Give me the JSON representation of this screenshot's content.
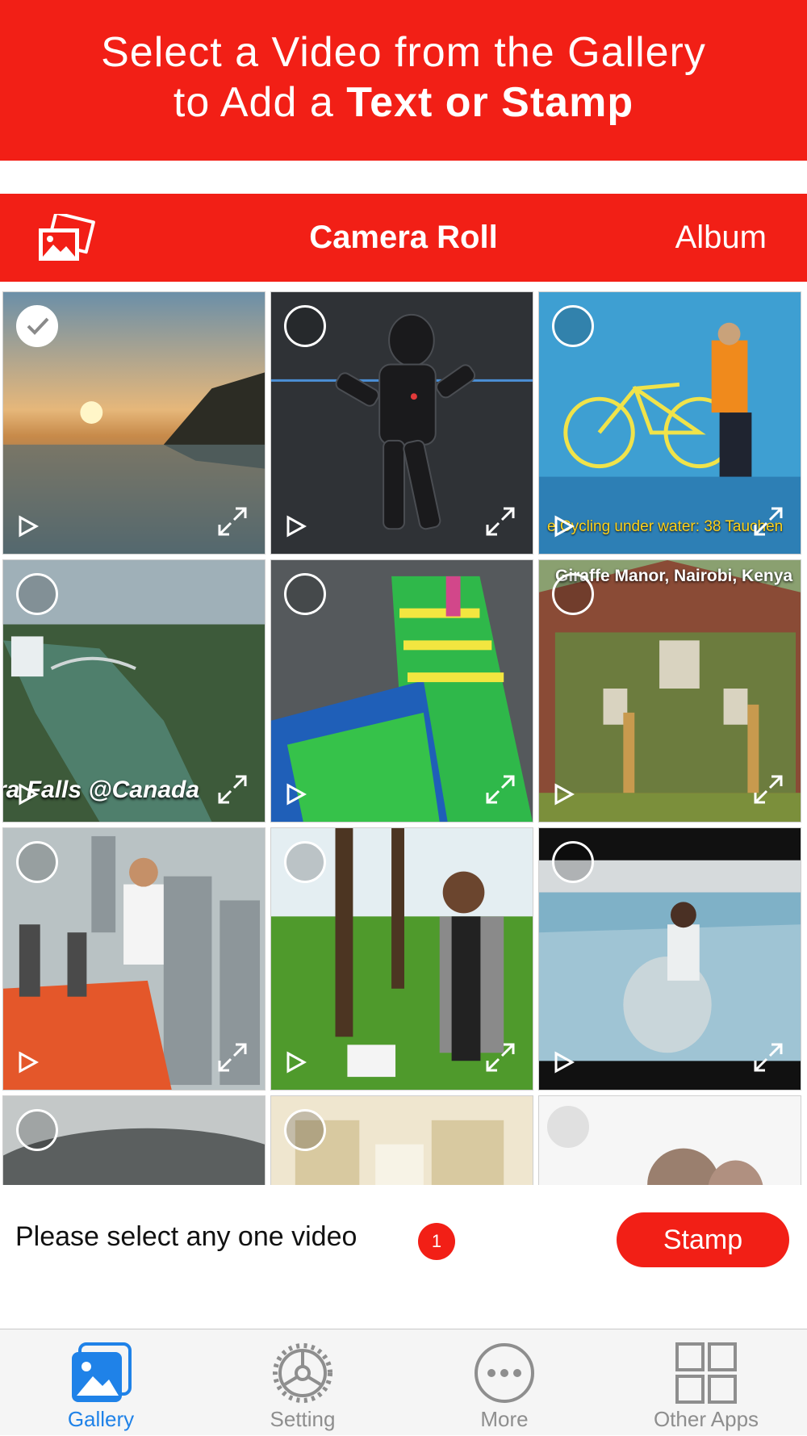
{
  "promo": {
    "line1": "Select a Video from the Gallery",
    "line2_prefix": "to Add a ",
    "line2_bold": "Text or Stamp"
  },
  "navbar": {
    "title": "Camera Roll",
    "album_label": "Album",
    "left_icon": "photos-icon"
  },
  "gallery": {
    "thumbnails": [
      {
        "selected": true
      },
      {
        "selected": false
      },
      {
        "selected": false,
        "caption": "e Cycling under water: 38 Tauchen"
      },
      {
        "selected": false,
        "caption": "ra Falls @Canada"
      },
      {
        "selected": false
      },
      {
        "selected": false,
        "caption": "Giraffe Manor, Nairobi, Kenya"
      },
      {
        "selected": false
      },
      {
        "selected": false
      },
      {
        "selected": false
      },
      {
        "selected": false
      },
      {
        "selected": false
      },
      {
        "selected": false
      }
    ]
  },
  "status": {
    "hint": "Please select any one video",
    "count": "1",
    "stamp_button": "Stamp"
  },
  "tabbar": {
    "tabs": [
      {
        "label": "Gallery",
        "icon": "gallery-icon",
        "active": true
      },
      {
        "label": "Setting",
        "icon": "gear-icon",
        "active": false
      },
      {
        "label": "More",
        "icon": "more-icon",
        "active": false
      },
      {
        "label": "Other Apps",
        "icon": "grid-icon",
        "active": false
      }
    ]
  },
  "colors": {
    "brand_red": "#f21f16",
    "active_tab_blue": "#1f82e8",
    "inactive_tab_gray": "#8e8e8e"
  }
}
